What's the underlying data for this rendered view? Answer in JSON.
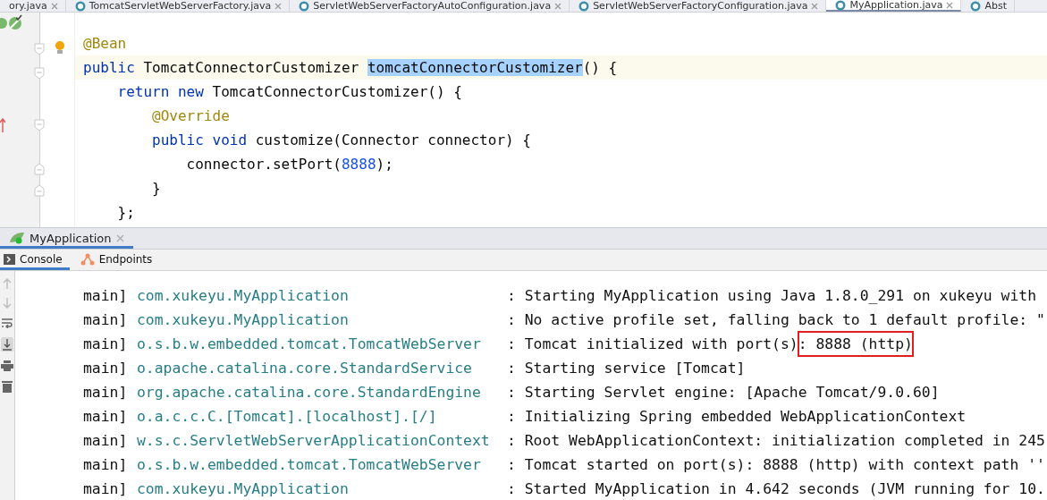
{
  "editor_tabs": [
    {
      "label": "ory.java",
      "selected": false
    },
    {
      "label": "TomcatServletWebServerFactory.java",
      "selected": false
    },
    {
      "label": "ServletWebServerFactoryAutoConfiguration.java",
      "selected": false
    },
    {
      "label": "ServletWebServerFactoryConfiguration.java",
      "selected": false
    },
    {
      "label": "MyApplication.java",
      "selected": true
    },
    {
      "label": "Abst",
      "selected": false
    }
  ],
  "code_lines": [
    {
      "current": false,
      "tokens": [
        {
          "kind": "annotation",
          "text": "@Bean"
        }
      ]
    },
    {
      "current": true,
      "tokens": [
        {
          "kind": "keyword",
          "text": "public "
        },
        {
          "kind": "plain",
          "text": "TomcatConnectorCustomizer "
        },
        {
          "kind": "selected",
          "text": "tomcatConnectorCustomizer"
        },
        {
          "kind": "plain",
          "text": "() {"
        }
      ]
    },
    {
      "current": false,
      "tokens": [
        {
          "kind": "keyword",
          "text": "    return new "
        },
        {
          "kind": "plain",
          "text": "TomcatConnectorCustomizer() {"
        }
      ]
    },
    {
      "current": false,
      "tokens": [
        {
          "kind": "annotation",
          "text": "        @Override"
        }
      ]
    },
    {
      "current": false,
      "tokens": [
        {
          "kind": "keyword",
          "text": "        public void "
        },
        {
          "kind": "plain",
          "text": "customize(Connector connector) {"
        }
      ]
    },
    {
      "current": false,
      "tokens": [
        {
          "kind": "plain",
          "text": "            connector.setPort("
        },
        {
          "kind": "number",
          "text": "8888"
        },
        {
          "kind": "plain",
          "text": ");"
        }
      ]
    },
    {
      "current": false,
      "tokens": [
        {
          "kind": "plain",
          "text": "        }"
        }
      ]
    },
    {
      "current": false,
      "tokens": [
        {
          "kind": "plain",
          "text": "    };"
        }
      ]
    }
  ],
  "run_tab": {
    "label": "MyApplication",
    "selected": true
  },
  "console_tabs": [
    {
      "label": "Console",
      "selected": true
    },
    {
      "label": "Endpoints",
      "selected": false
    }
  ],
  "log_rows": [
    {
      "thread": "main]",
      "logger": "com.xukeyu.MyApplication",
      "message": ": Starting MyApplication using Java 1.8.0_291 on xukeyu with"
    },
    {
      "thread": "main]",
      "logger": "com.xukeyu.MyApplication",
      "message": ": No active profile set, falling back to 1 default profile: \""
    },
    {
      "thread": "main]",
      "logger": "o.s.b.w.embedded.tomcat.TomcatWebServer",
      "message": ": Tomcat initialized with port(s)",
      "boxed": ": 8888 (http)"
    },
    {
      "thread": "main]",
      "logger": "o.apache.catalina.core.StandardService",
      "message": ": Starting service [Tomcat]"
    },
    {
      "thread": "main]",
      "logger": "org.apache.catalina.core.StandardEngine",
      "message": ": Starting Servlet engine: [Apache Tomcat/9.0.60]"
    },
    {
      "thread": "main]",
      "logger": "o.a.c.c.C.[Tomcat].[localhost].[/]",
      "message": ": Initializing Spring embedded WebApplicationContext"
    },
    {
      "thread": "main]",
      "logger": "w.s.c.ServletWebServerApplicationContext",
      "message": ": Root WebApplicationContext: initialization completed in 245"
    },
    {
      "thread": "main]",
      "logger": "o.s.b.w.embedded.tomcat.TomcatWebServer",
      "message": ": Tomcat started on port(s): 8888 (http) with context path ''"
    },
    {
      "thread": "main]",
      "logger": "com.xukeyu.MyApplication",
      "message": ": Started MyApplication in 4.642 seconds (JVM running for 10."
    }
  ]
}
